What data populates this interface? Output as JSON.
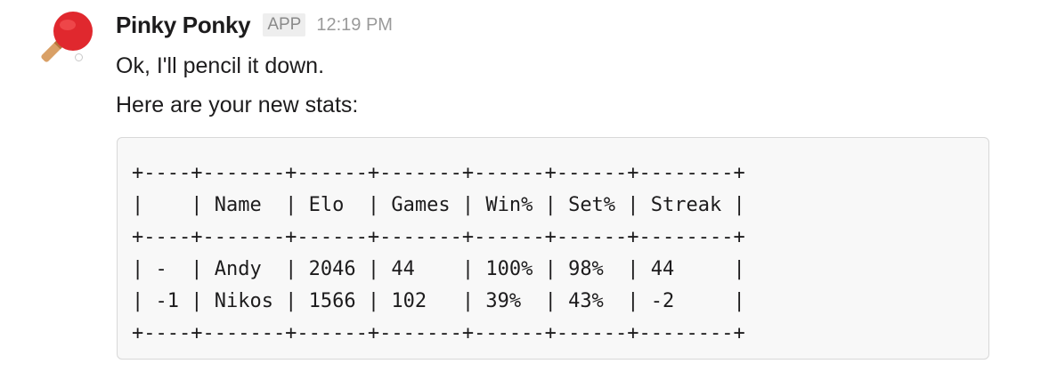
{
  "message": {
    "sender_name": "Pinky Ponky",
    "app_badge": "APP",
    "timestamp": "12:19 PM",
    "avatar_icon": "ping-pong-paddle-icon",
    "lines": [
      "Ok, I'll pencil it down.",
      "Here are your new stats:"
    ],
    "code_block": [
      "+----+-------+------+-------+------+------+--------+",
      "|    | Name  | Elo  | Games | Win% | Set% | Streak |",
      "+----+-------+------+-------+------+------+--------+",
      "| -  | Andy  | 2046 | 44    | 100% | 98%  | 44     |",
      "| -1 | Nikos | 1566 | 102   | 39%  | 43%  | -2     |",
      "+----+-------+------+-------+------+------+--------+"
    ]
  },
  "colors": {
    "paddle_red": "#e0282e",
    "handle": "#d9a066",
    "code_bg": "#f8f8f8",
    "code_border": "#d8d8d8"
  }
}
